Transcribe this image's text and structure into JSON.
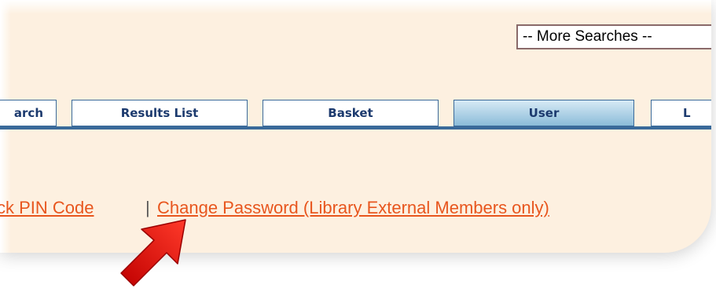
{
  "search": {
    "select_value": "-- More Searches --"
  },
  "tabs": [
    {
      "label": "arch",
      "active": false
    },
    {
      "label": "Results List",
      "active": false
    },
    {
      "label": "Basket",
      "active": false
    },
    {
      "label": "User",
      "active": true
    },
    {
      "label": "L",
      "active": false
    }
  ],
  "links": {
    "pin_code": "ck PIN Code",
    "separator": "|",
    "change_password": "Change Password (Library External Members only)"
  },
  "colors": {
    "background": "#fdf0e0",
    "link": "#e8561e",
    "tab_border": "#3a6a9a",
    "tab_text": "#1c3a6e",
    "arrow": "#e02020"
  },
  "icons": {
    "pointer_arrow": "red-arrow-icon"
  }
}
